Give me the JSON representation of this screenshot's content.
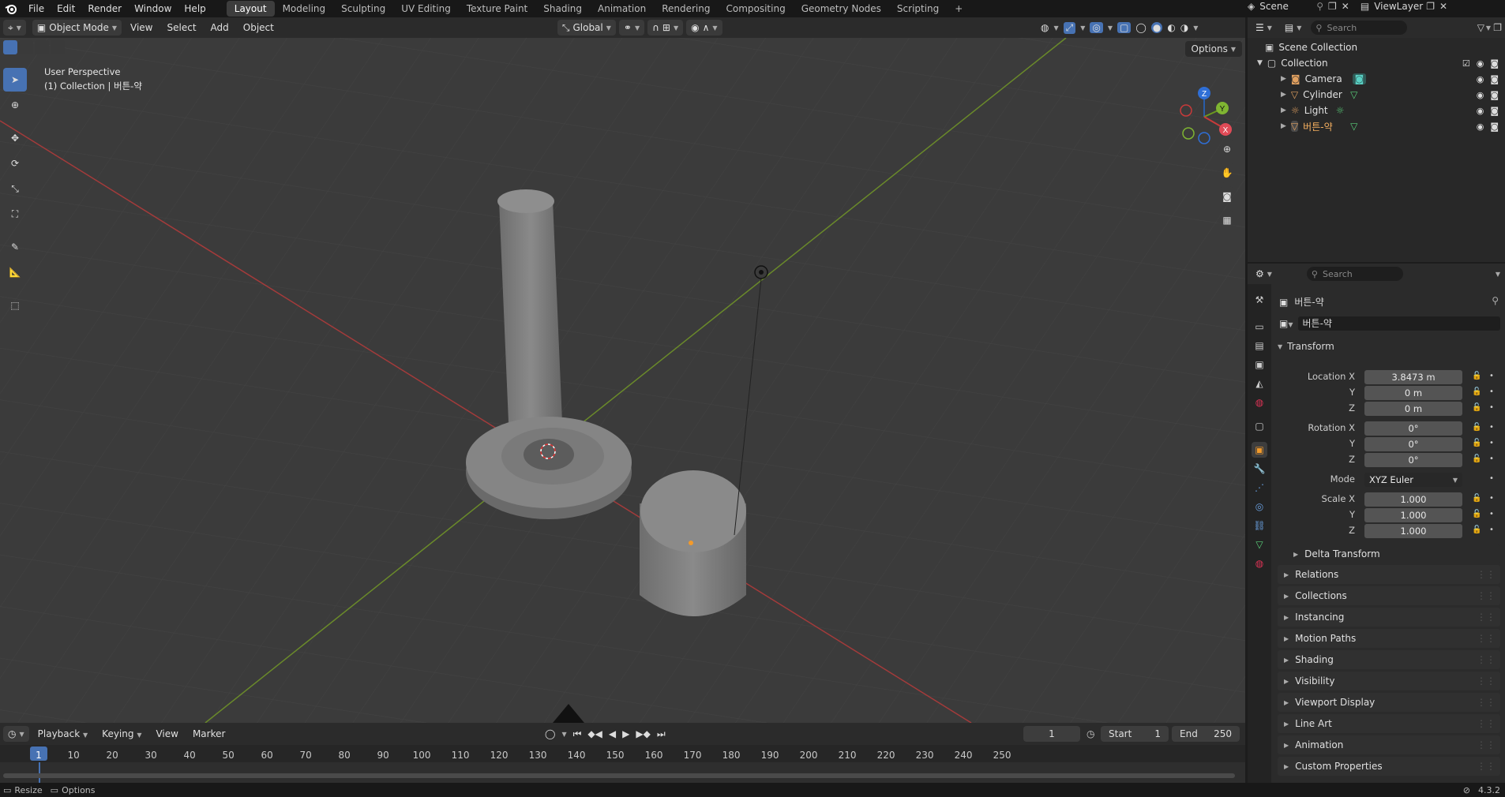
{
  "topbar": {
    "menus": [
      "File",
      "Edit",
      "Render",
      "Window",
      "Help"
    ],
    "workspaces": [
      "Layout",
      "Modeling",
      "Sculpting",
      "UV Editing",
      "Texture Paint",
      "Shading",
      "Animation",
      "Rendering",
      "Compositing",
      "Geometry Nodes",
      "Scripting"
    ],
    "active_workspace": "Layout",
    "add_tab": "+",
    "scene": "Scene",
    "view_layer": "ViewLayer"
  },
  "viewport_header": {
    "mode": "Object Mode",
    "menus": [
      "View",
      "Select",
      "Add",
      "Object"
    ],
    "orientation": "Global"
  },
  "viewport": {
    "perspective": "User Perspective",
    "collection_info": "(1) Collection | 버튼-약",
    "options": "Options",
    "gizmo": {
      "z": "Z",
      "y": "Y",
      "x": "X"
    }
  },
  "timeline": {
    "menus": [
      "Playback",
      "Keying",
      "View",
      "Marker"
    ],
    "current_frame": "1",
    "start_label": "Start",
    "start": "1",
    "end_label": "End",
    "end": "250",
    "ticks": [
      "1",
      "10",
      "20",
      "30",
      "40",
      "50",
      "60",
      "70",
      "80",
      "90",
      "100",
      "110",
      "120",
      "130",
      "140",
      "150",
      "160",
      "170",
      "180",
      "190",
      "200",
      "210",
      "220",
      "230",
      "240",
      "250"
    ]
  },
  "statusbar": {
    "left1": "Resize",
    "left2": "Options",
    "version": "4.3.2"
  },
  "outliner": {
    "search_placeholder": "Search",
    "scene_collection": "Scene Collection",
    "collection": "Collection",
    "items": [
      {
        "name": "Camera",
        "color": "#e0a060"
      },
      {
        "name": "Cylinder",
        "color": "#e0a060"
      },
      {
        "name": "Light",
        "color": "#e0a060"
      },
      {
        "name": "버튼-약",
        "color": "#e0a060"
      }
    ]
  },
  "properties": {
    "search_placeholder": "Search",
    "object_name": "버튼-약",
    "datablock_name": "버튼-약",
    "transform_title": "Transform",
    "location_label": "Location X",
    "location": [
      "3.8473 m",
      "0 m",
      "0 m"
    ],
    "rotation_label": "Rotation X",
    "rotation": [
      "0°",
      "0°",
      "0°"
    ],
    "mode_label": "Mode",
    "mode": "XYZ Euler",
    "scale_label": "Scale X",
    "scale": [
      "1.000",
      "1.000",
      "1.000"
    ],
    "y_label": "Y",
    "z_label": "Z",
    "delta_transform": "Delta Transform",
    "panels": [
      "Relations",
      "Collections",
      "Instancing",
      "Motion Paths",
      "Shading",
      "Visibility",
      "Viewport Display",
      "Line Art",
      "Animation",
      "Custom Properties"
    ]
  }
}
